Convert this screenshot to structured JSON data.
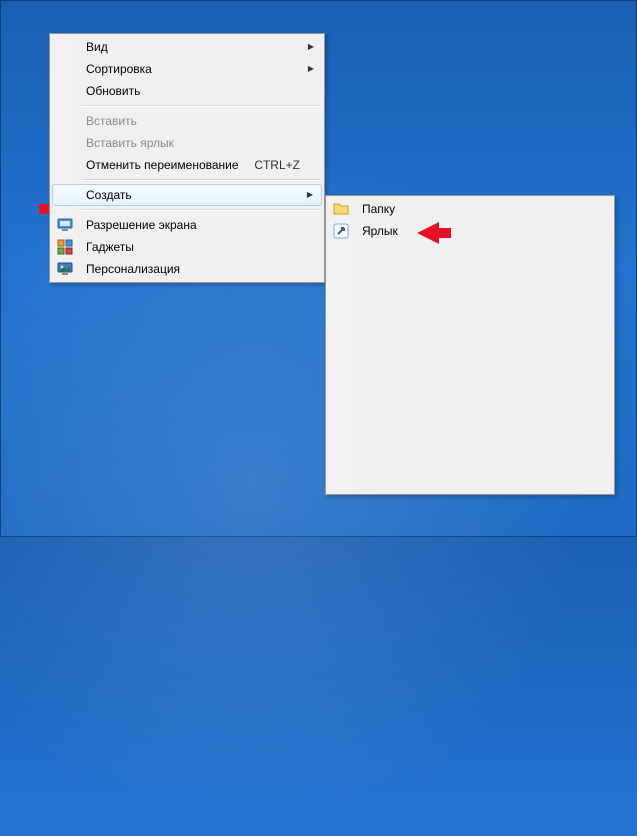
{
  "main_menu": {
    "view": "Вид",
    "sort": "Сортировка",
    "refresh": "Обновить",
    "paste": "Вставить",
    "paste_shortcut": "Вставить ярлык",
    "undo_rename": "Отменить переименование",
    "undo_rename_key": "CTRL+Z",
    "create": "Создать",
    "screen_res": "Разрешение экрана",
    "gadgets": "Гаджеты",
    "personalize": "Персонализация"
  },
  "sub_menu": {
    "folder": "Папку",
    "shortcut": "Ярлык"
  },
  "icons": {
    "screen_res": "monitor-icon",
    "gadgets": "gadgets-icon",
    "personalize": "personalize-icon",
    "folder": "folder-icon",
    "shortcut": "shortcut-icon"
  }
}
